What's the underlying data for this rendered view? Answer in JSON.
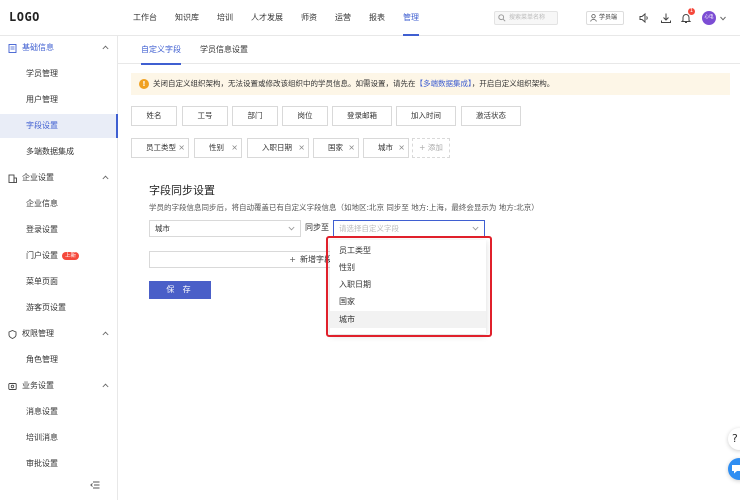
{
  "header": {
    "logo": "LOGO",
    "nav": [
      "工作台",
      "知识库",
      "培训",
      "人才发展",
      "师资",
      "运营",
      "报表",
      "管理"
    ],
    "active_nav_index": 7,
    "search_placeholder": "搜索菜单名称",
    "student_end_label": "学员端",
    "notification_count": "1",
    "avatar_text": "心电",
    "accent_color": "#3f5fd1"
  },
  "sidebar": {
    "groups": [
      {
        "label": "基础信息",
        "icon": "document-icon",
        "items": [
          "学员管理",
          "用户管理",
          "字段设置",
          "多端数据集成"
        ]
      },
      {
        "label": "企业设置",
        "icon": "building-icon",
        "items": [
          "企业信息",
          "登录设置",
          "门户设置",
          "菜单页面",
          "游客页设置"
        ]
      },
      {
        "label": "权限管理",
        "icon": "shield-icon",
        "items": [
          "角色管理"
        ]
      },
      {
        "label": "业务设置",
        "icon": "settings-icon",
        "items": [
          "消息设置",
          "培训消息",
          "审批设置"
        ]
      }
    ],
    "active_item": "字段设置",
    "new_badge": "上新"
  },
  "tabs": [
    "自定义字段",
    "学员信息设置"
  ],
  "active_tab_index": 0,
  "notice": {
    "text_before": "关闭自定义组织架构，无法设置或修改该组织中的学员信息。如需设置，请先在",
    "link_text": "【多端数据集成】",
    "text_after": "，开启自定义组织架构。"
  },
  "fixed_fields": [
    "姓名",
    "工号",
    "部门",
    "岗位",
    "登录邮箱",
    "加入时间",
    "激活状态"
  ],
  "custom_fields": [
    "员工类型",
    "性别",
    "入职日期",
    "国家",
    "城市"
  ],
  "add_chip_label": "+ 添加",
  "sync_section": {
    "title": "字段同步设置",
    "description": "学员的字段信息同步后，将自动覆盖已有自定义字段信息（如地区:北京 同步至 地方:上海，最终会显示为 地方:北京）",
    "source_value": "城市",
    "sync_label": "同步至",
    "target_placeholder": "请选择自定义字段",
    "add_field_label": "新增字段",
    "save_label": "保 存",
    "dropdown_options": [
      "员工类型",
      "性别",
      "入职日期",
      "国家",
      "城市"
    ],
    "dropdown_highlighted_index": 4
  },
  "float_help": "?"
}
